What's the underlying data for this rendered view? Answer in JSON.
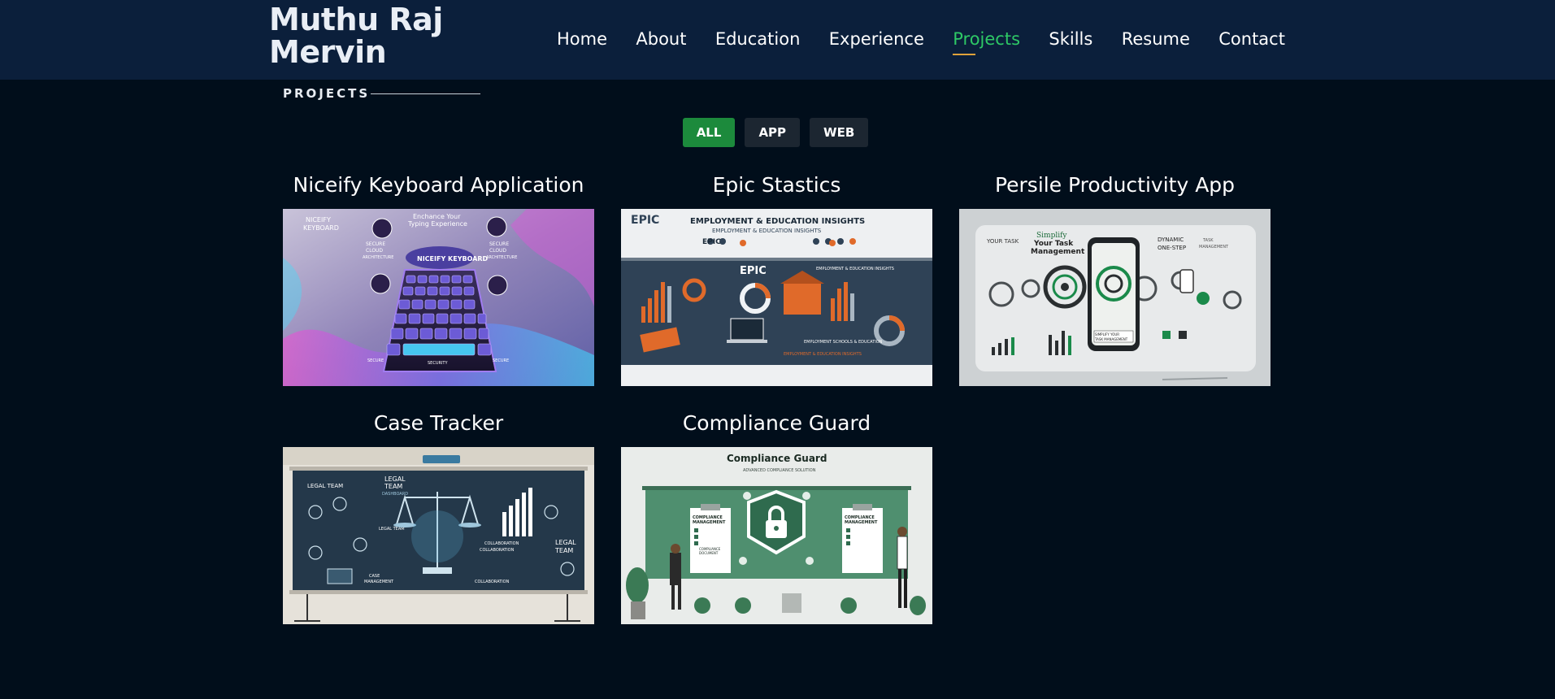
{
  "header": {
    "logo_line1": "Muthu Raj",
    "logo_line2": "Mervin",
    "nav": [
      "Home",
      "About",
      "Education",
      "Experience",
      "Projects",
      "Skills",
      "Resume",
      "Contact"
    ],
    "active_nav": "Projects",
    "active_color": "#2ec866",
    "underline_color": "#e0a23a"
  },
  "section": {
    "label": "PROJECTS"
  },
  "filters": {
    "all": "ALL",
    "app": "APP",
    "web": "WEB",
    "active": "ALL",
    "active_color": "#1c8a3c"
  },
  "projects": [
    {
      "title": "Niceify Keyboard Application",
      "image_text": [
        "NICEIFY",
        "KEYBOARD",
        "Enchance Your",
        "Typing Experience",
        "NICEIFY KEYBOARD",
        "SECURE",
        "CLOUD",
        "ARCHITECTURE",
        "SECURE",
        "CLOUD",
        "ARCHITECTURE",
        "SECURE",
        "SECURITY",
        "SECURE"
      ]
    },
    {
      "title": "Epic Stastics",
      "image_text": [
        "EPIC",
        "EMPLOYMENT & EDUCATION INSIGHTS",
        "EMPLOYMENT & EDUCATION INSIGHTS",
        "EPIC",
        "EPIC",
        "EMPLOYMENT & EDUCATION INSIGHTS",
        "EMPLOYMENT SCHOOLS & EDUCATION",
        "EMPLOYMENT & EDUCATION INSIGHTS"
      ]
    },
    {
      "title": "Persile Productivity App",
      "image_text": [
        "YOUR TASK",
        "Simplify",
        "Your Task",
        "Management",
        "DYNAMIC",
        "ONE-STEP",
        "TASK",
        "MANAGEMENT",
        "SIMPLIFY YOUR",
        "TASK MANAGEMENT"
      ]
    },
    {
      "title": "Case Tracker",
      "image_text": [
        "LEGAL TEAM",
        "LEGAL",
        "TEAM",
        "DASHBOARD",
        "LEGAL TEAM",
        "COLLABORATION",
        "COLLABORATION",
        "LEGAL",
        "TEAM",
        "CASE",
        "MANAGEMENT",
        "COLLABORATION"
      ]
    },
    {
      "title": "Compliance Guard",
      "image_text": [
        "Compliance Guard",
        "ADVANCED COMPLIANCE SOLUTION",
        "COMPLIANCE",
        "MANAGEMENT",
        "COMPLIANCE",
        "MANAGEMENT",
        "COMPLIANCE",
        "DOCUMENT"
      ]
    }
  ]
}
